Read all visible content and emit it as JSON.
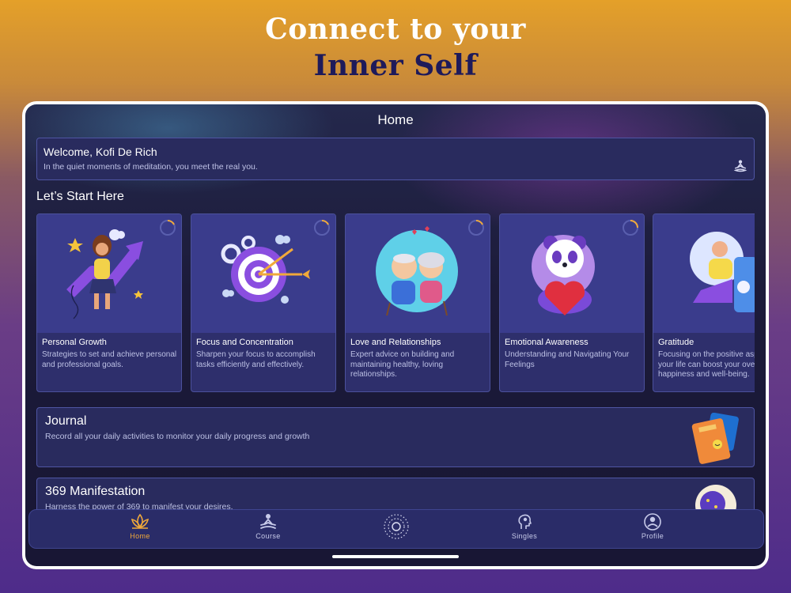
{
  "headline": {
    "line1": "Connect to your",
    "line2": "Inner Self"
  },
  "screen": {
    "title": "Home"
  },
  "welcome": {
    "greeting": "Welcome,  Kofi De Rich",
    "subtitle": "In the quiet moments of meditation, you meet the real you.",
    "icon": "meditation-icon"
  },
  "section": {
    "title": "Let’s Start Here"
  },
  "cards": [
    {
      "title": "Personal Growth",
      "description": "Strategies to set and achieve personal and professional goals."
    },
    {
      "title": "Focus and Concentration",
      "description": "Sharpen your focus to accomplish tasks efficiently and effectively."
    },
    {
      "title": "Love and Relationships",
      "description": "Expert advice on building and maintaining healthy, loving relationships."
    },
    {
      "title": "Emotional Awareness",
      "description": "Understanding and Navigating Your Feelings"
    },
    {
      "title": "Gratitude",
      "description": "Focusing on the positive aspects of your life can boost your overall happiness and well-being."
    }
  ],
  "journal": {
    "title": "Journal",
    "description": "Record all your daily activities to monitor your daily progress and growth"
  },
  "manifestation": {
    "title": "369 Manifestation",
    "description": "Harness the power of 369 to manifest your desires."
  },
  "tabs": [
    {
      "label": "Home",
      "icon": "lotus-icon",
      "active": true
    },
    {
      "label": "Course",
      "icon": "meditation-icon"
    },
    {
      "label": "",
      "icon": "mandala-icon"
    },
    {
      "label": "Singles",
      "icon": "mind-icon"
    },
    {
      "label": "Profile",
      "icon": "profile-icon"
    }
  ],
  "colors": {
    "accent": "#f0a93a",
    "card": "#2e2f6c",
    "panel": "#292b5e",
    "headline_dark": "#1e1a5a"
  }
}
